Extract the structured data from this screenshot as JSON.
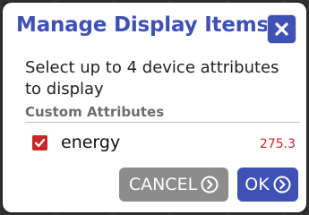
{
  "dialog": {
    "title": "Manage Display Items",
    "description": "Select up to 4 device attributes to display",
    "section_label": "Custom Attributes"
  },
  "attributes": [
    {
      "name": "energy",
      "value": "275.3",
      "checked": true
    }
  ],
  "buttons": {
    "cancel_label": "CANCEL",
    "ok_label": "OK"
  },
  "colors": {
    "accent": "#3f51b5",
    "check": "#c62828",
    "value": "#c62828",
    "cancel_bg": "#8c8c8c"
  },
  "icons": {
    "close": "close-icon",
    "checkbox": "check-icon",
    "cancel": "chevron-right-circle-icon",
    "ok": "chevron-right-circle-icon"
  }
}
